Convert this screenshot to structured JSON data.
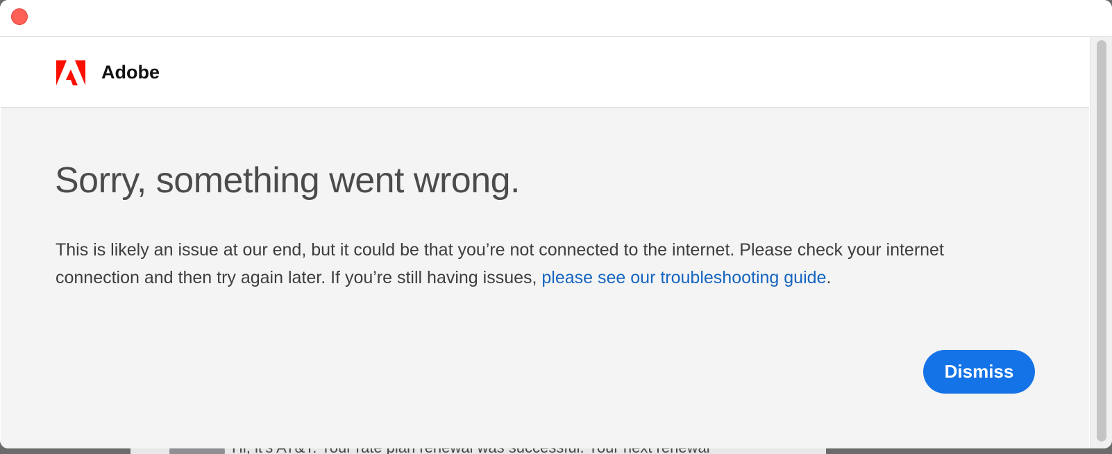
{
  "brand": {
    "name": "Adobe",
    "logo_color": "#fa0f00"
  },
  "error": {
    "headline": "Sorry, something went wrong.",
    "message": "This is likely an issue at our end, but it could be that you’re not connected to the internet. Please check your internet connection and then try again later. If you’re still having issues, ",
    "link_text": "please see our troubleshooting guide",
    "trailing": "."
  },
  "actions": {
    "dismiss_label": "Dismiss",
    "accent_color": "#1473e6"
  },
  "background_app": {
    "notification_text": "Hi, it's AT&T: Your rate plan renewal was successful. Your next renewal"
  },
  "icons": {
    "close": "close-icon",
    "logo": "adobe-logo-icon"
  }
}
